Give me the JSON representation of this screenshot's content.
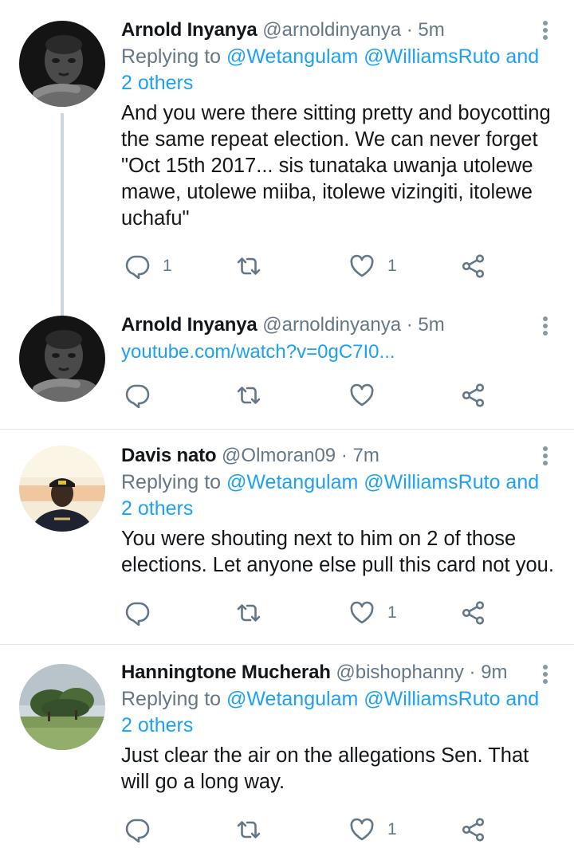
{
  "tweets": [
    {
      "name": "Arnold Inyanya",
      "handle": "@arnoldinyanya",
      "time": "5m",
      "replying_prefix": "Replying to",
      "replying_links": "@Wetangulam @WilliamsRuto and",
      "replying_others": "2 others",
      "text": "And you were there sitting pretty and boycotting the same repeat election. We can never forget \"Oct 15th 2017... sis tunataka uwanja utolewe mawe, utolewe miiba, itolewe vizingiti, itolewe uchafu\"",
      "reply_count": "1",
      "retweet_count": "",
      "like_count": "1"
    },
    {
      "name": "Arnold Inyanya",
      "handle": "@arnoldinyanya",
      "time": "5m",
      "url": "youtube.com/watch?v=0gC7I0...",
      "reply_count": "",
      "retweet_count": "",
      "like_count": ""
    },
    {
      "name": "Davis nato",
      "handle": "@Olmoran09",
      "time": "7m",
      "replying_prefix": "Replying to",
      "replying_links": "@Wetangulam @WilliamsRuto and",
      "replying_others": "2 others",
      "text": "You were shouting next to him on 2 of those elections. Let anyone else pull this card not you.",
      "reply_count": "",
      "retweet_count": "",
      "like_count": "1"
    },
    {
      "name": "Hanningtone Mucherah",
      "handle": "@bishophanny",
      "time": "9m",
      "replying_prefix": "Replying to",
      "replying_links": "@Wetangulam @WilliamsRuto and",
      "replying_others": "2 others",
      "text": "Just clear the air on the allegations Sen. That will go a long way.",
      "reply_count": "",
      "retweet_count": "",
      "like_count": "1"
    }
  ],
  "separator": "·",
  "icons": {
    "reply": "reply-icon",
    "retweet": "retweet-icon",
    "like": "heart-icon",
    "share": "share-icon",
    "more": "more-options-icon"
  },
  "colors": {
    "link": "#1da1f2",
    "secondary": "#657786",
    "icon": "#657786",
    "divider": "#e1e8ed",
    "thread_line": "#ccd6dd"
  }
}
